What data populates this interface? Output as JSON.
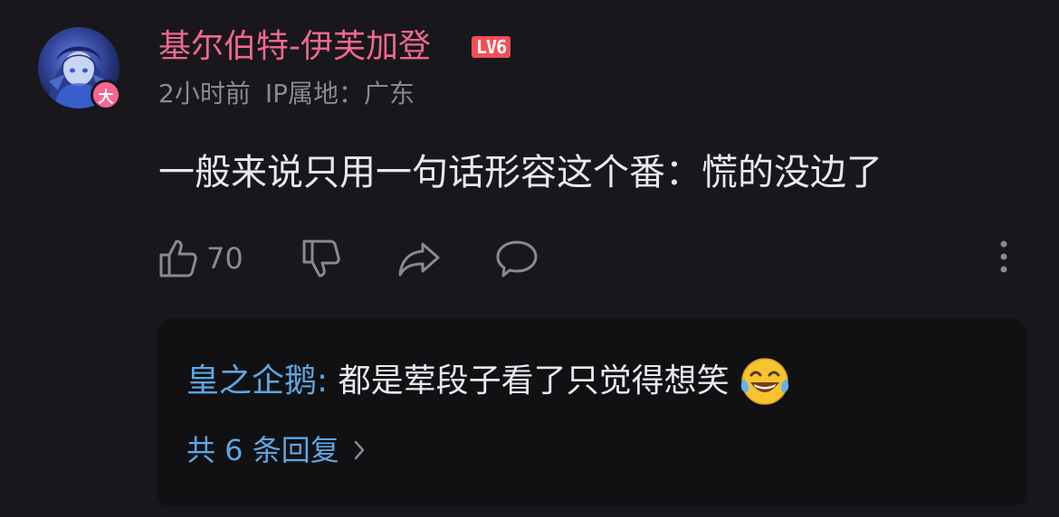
{
  "comment": {
    "username": "基尔伯特-伊芙加登",
    "level_badge": "LV6",
    "vip_badge": "大",
    "time": "2小时前",
    "ip_location": "IP属地：广东",
    "text": "一般来说只用一句话形容这个番：慌的没边了",
    "like_count": "70",
    "colors": {
      "username": "#f0678f",
      "level_badge": "#f24f59",
      "link": "#5ca7e3",
      "background": "#18171c",
      "reply_background": "#111013"
    }
  },
  "actions": {
    "like_icon": "thumbs-up-icon",
    "dislike_icon": "thumbs-down-icon",
    "share_icon": "share-icon",
    "reply_icon": "comment-bubble-icon",
    "more_icon": "more-vertical-icon"
  },
  "replies": {
    "preview_user": "皇之企鹅",
    "preview_separator": ": ",
    "preview_text": "都是荤段子看了只觉得想笑",
    "preview_emoji": "😂",
    "more_replies_label": "共 6 条回复",
    "chevron_icon": "chevron-right-icon"
  }
}
